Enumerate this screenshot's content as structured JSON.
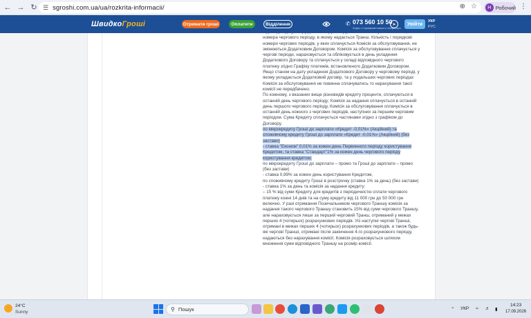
{
  "browser": {
    "url": "sgroshi.com.ua/ua/rozkrita-informacii/",
    "profile_initial": "Н",
    "profile_name": "Робочий"
  },
  "header": {
    "logo_main": "Швидко",
    "logo_accent": "Гроші",
    "btn_get_money": "Отримати гроші",
    "btn_pay": "Оплатити",
    "btn_branches": "Відділення",
    "phone": "073 560 10 50",
    "phone_note": "Згідно з тарифами вашого оператора",
    "login": "Увійти",
    "lang_active": "УКР",
    "lang_other": "РУС"
  },
  "content": {
    "paragraphs": [
      {
        "text": "відповідно до умов Додаткового Договору, за яким сплачується Комісія, та номера чергового періоду, в якому надається Транш. Кількість і порядкові номери чергових періодів, у яких сплачується Комісія за обслуговування, не змінюються Додатковим Договором. Комісія за обслуговування сплачується у чергові періоди, нараховується та обліковується в день укладення Додаткового Договору та сплачується у складі відповідного чергового платежу згідно Графіку платежів, встановленого Додатковим Договором. Якщо станом на дату укладення Додаткового Договору у черговому періоді, у якому укладається Додатковий договір, та у подальших чергових періодах Комісія за обслуговування не повинна сплачуватись то нарахування такої комісії не передбачено.",
        "highlight": false
      },
      {
        "text": "По кожному, з вказаних вище різновидів кредиту проценти, сплачуються в останній день чергового періоду; Комісія за надання сплачується в останній день першого чергового періоду, Комісія за обслуговування сплачується в останній день кожного з чергових періодів, наступних за першим черговим періодом. Сума Кредиту сплачується частинами  згідно з графіком до Договору.",
        "highlight": false
      },
      {
        "text": "по мікрокредиту Гроші до зарплати «Кредит -0,01%» (Акційний) та споживчому кредиту Гроші до зарплати «Кредит -0,01%» (Акційний) (без застави)",
        "highlight": true
      },
      {
        "text": "- ставка \"Економ\" 0,01% за кожен день Первинного періоду користування Кредитом, та ставка \"Стандарт\"1% за кожен день чергового періоду користування кредитом;",
        "highlight": true
      },
      {
        "text": "по мікрокредиту Гроші до зарплати – промо та Гроші до зарплати – промо (без застави)",
        "highlight": false
      },
      {
        "text": "- ставка 0,99% за кожен день користування Кредитом,",
        "highlight": false
      },
      {
        "text": "по споживчому кредиту Гроші в розстрочку (ставка 1% за день) (без застави)",
        "highlight": false
      },
      {
        "text": "- ставка 1% за день та комісія за надання кредиту:",
        "highlight": false
      },
      {
        "text": "– 15 %  від суми Кредиту для кредитів з періодичністю сплати чергового платежу кожні 14 днів та на суму кредиту від 11 000 грн до 50 000 грн включно. У разі отримання Позичальником чергового Траншу комісія за надання такого чергового Траншу становить 15% від суми чергового Траншу, але нараховується лише за перший черговий Транш, отриманий у межах перших 4 (чотирьох) розрахункових періодів. Усі наступні чергові Транші, отримані в межах перших 4 (чотирьох) розрахункових періодів, а також будь-які чергові Транші, отримані після закінчення 4-го розрахункового періоду, надаються без нарахування комісії. Комісія розраховується шляхом множення суми відповідного Траншу на розмір комісії.",
        "highlight": false
      }
    ]
  },
  "taskbar": {
    "weather_temp": "24°C",
    "weather_desc": "Sunny",
    "search_placeholder": "Пошук",
    "lang": "УКР",
    "time": "14:23",
    "date": "17.09.2026"
  }
}
